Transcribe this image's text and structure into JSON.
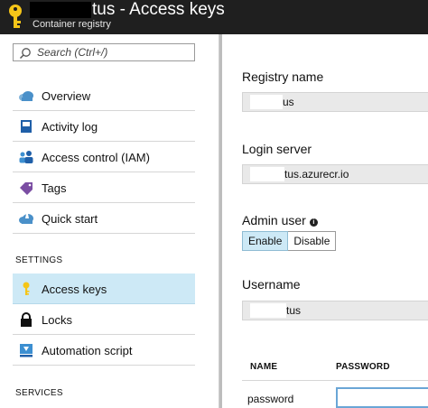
{
  "header": {
    "title": "tus - Access keys",
    "subtitle": "Container registry",
    "icon": "key-icon",
    "icon_color": "#f5c518"
  },
  "sidebar": {
    "search_placeholder": "Search (Ctrl+/)",
    "items": [
      {
        "label": "Overview",
        "icon": "cloud-icon"
      },
      {
        "label": "Activity log",
        "icon": "log-book-icon"
      },
      {
        "label": "Access control (IAM)",
        "icon": "users-icon"
      },
      {
        "label": "Tags",
        "icon": "tag-icon"
      },
      {
        "label": "Quick start",
        "icon": "quick-start-cloud-icon"
      }
    ],
    "settings_label": "SETTINGS",
    "settings_items": [
      {
        "label": "Access keys",
        "icon": "key-icon",
        "active": true
      },
      {
        "label": "Locks",
        "icon": "lock-icon"
      },
      {
        "label": "Automation script",
        "icon": "download-script-icon"
      }
    ],
    "services_label": "SERVICES",
    "active_color": "#cde9f6"
  },
  "main": {
    "registry_name": {
      "label": "Registry name",
      "value": "us"
    },
    "login_server": {
      "label": "Login server",
      "value": "tus.azurecr.io"
    },
    "admin_user": {
      "label": "Admin user",
      "enable_label": "Enable",
      "disable_label": "Disable",
      "selected": "Enable"
    },
    "username": {
      "label": "Username",
      "value": "tus"
    },
    "table": {
      "columns": [
        "NAME",
        "PASSWORD"
      ],
      "rows": [
        {
          "name": "password",
          "password": ""
        }
      ]
    }
  }
}
